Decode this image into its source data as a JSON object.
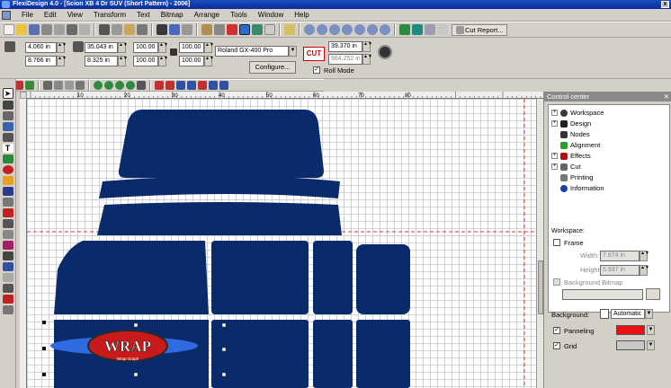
{
  "window": {
    "title": "FlexiDesign 4.0 - [Scion XB 4 Dr SUV (Short Pattern) - 2006]",
    "close_glyph": "x"
  },
  "menu": {
    "items": [
      "File",
      "Edit",
      "View",
      "Transform",
      "Text",
      "Bitmap",
      "Arrange",
      "Tools",
      "Window",
      "Help"
    ]
  },
  "toolbar": {
    "cut_report_label": "Cut Report..."
  },
  "properties": {
    "x": "4.060 in",
    "y": "8.766 in",
    "width": "35.043 in",
    "height": "8.325 in",
    "scale_x": "100.00",
    "scale_y": "100.00",
    "scale_x2": "100.00",
    "scale_y2": "100.00",
    "device": "Roland GX-400 Pro",
    "configure_label": "Configure...",
    "cut_badge": "CUT",
    "media_width": "39.370 in",
    "media_length": "984.252 in",
    "roll_mode_label": "Roll Mode",
    "roll_mode_checked": true
  },
  "ruler": {
    "labels": [
      "10",
      "20",
      "30",
      "40",
      "50",
      "60",
      "70",
      "80"
    ]
  },
  "control_center": {
    "title": "Control center",
    "tree": [
      {
        "label": "Workspace",
        "expand": "+",
        "icon": "workspace-icon",
        "color": "#3a3a3a"
      },
      {
        "label": "Design",
        "expand": "+",
        "icon": "pointer-icon",
        "color": "#222222"
      },
      {
        "label": "Nodes",
        "expand": "",
        "icon": "nodes-icon",
        "color": "#333333"
      },
      {
        "label": "Alignment",
        "expand": "",
        "icon": "alignment-icon",
        "color": "#2a9d2a"
      },
      {
        "label": "Effects",
        "expand": "+",
        "icon": "effects-icon",
        "color": "#b01010"
      },
      {
        "label": "Cut",
        "expand": "+",
        "icon": "knife-icon",
        "color": "#666666"
      },
      {
        "label": "Printing",
        "expand": "",
        "icon": "printer-icon",
        "color": "#777777"
      },
      {
        "label": "Information",
        "expand": "",
        "icon": "info-icon",
        "color": "#1a3fa8"
      }
    ],
    "workspace": {
      "section_label": "Workspace:",
      "frame_label": "Frame",
      "frame_checked": false,
      "width_label": "Width:",
      "width_value": "7.874 in",
      "height_label": "Height:",
      "height_value": "5.937 in",
      "bg_bitmap_label": "Background Bitmap",
      "background_label": "Background:",
      "background_value": "Automatic",
      "panneling_label": "Panneling",
      "panneling_checked": true,
      "panneling_color": "#e81010",
      "grid_label": "Grid",
      "grid_checked": true,
      "grid_color": "#c8c8c8"
    }
  },
  "design": {
    "shape_color": "#0a2b6b",
    "logo_text": "WRAP",
    "logo_sub": "Wrap Graph",
    "logo_color": "#c81a1a"
  }
}
